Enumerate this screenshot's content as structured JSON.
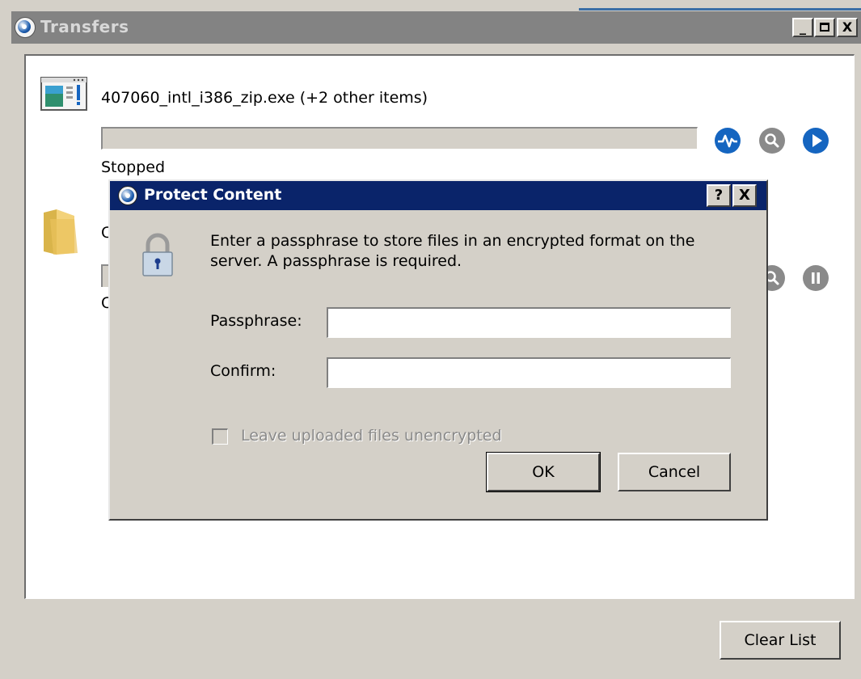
{
  "window": {
    "title": "Transfers",
    "controls": {
      "minimize": "_",
      "maximize": "□",
      "close": "X"
    }
  },
  "transfers": [
    {
      "name": "407060_intl_i386_zip.exe (+2 other items)",
      "status": "Stopped",
      "actions": [
        "activity-icon",
        "search-icon",
        "play-icon"
      ]
    },
    {
      "name_visible": "C",
      "status_visible": "C",
      "actions": [
        "search-icon",
        "pause-icon"
      ]
    }
  ],
  "footer": {
    "clear_label": "Clear List"
  },
  "dialog": {
    "title": "Protect Content",
    "help_label": "?",
    "close_label": "X",
    "message": "Enter a passphrase to store files in an encrypted format on the server. A passphrase is required.",
    "passphrase_label": "Passphrase:",
    "passphrase_value": "",
    "confirm_label": "Confirm:",
    "confirm_value": "",
    "leave_unencrypted_label": "Leave uploaded files unencrypted",
    "leave_unencrypted_checked": false,
    "ok_label": "OK",
    "cancel_label": "Cancel"
  },
  "colors": {
    "dialog_titlebar": "#0a246a",
    "window_titlebar_inactive": "#838383",
    "action_blue": "#1565c0",
    "action_gray": "#8a8a8a"
  }
}
